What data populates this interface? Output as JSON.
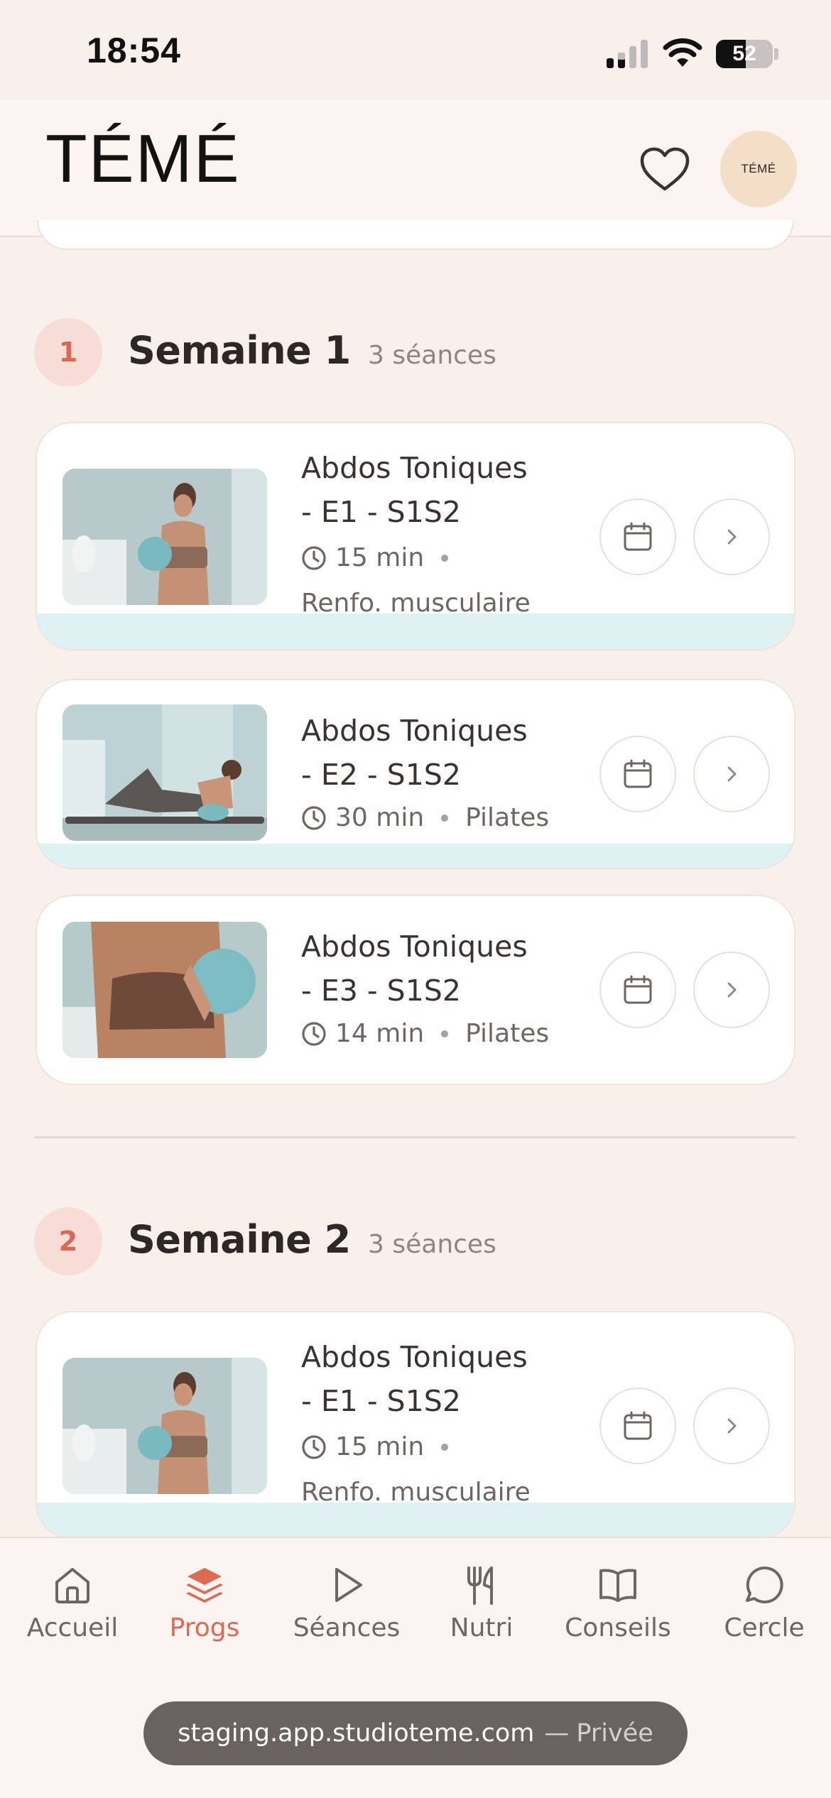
{
  "status_bar": {
    "time": "18:54",
    "battery": "52",
    "battery_level": 0.52
  },
  "header": {
    "logo": "TÉMÉ",
    "avatar_text": "TÉMÉ",
    "favorite_icon": "heart-icon"
  },
  "weeks": [
    {
      "number": "1",
      "title": "Semaine 1",
      "count": "3 séances",
      "sessions": [
        {
          "title_line1": "Abdos Toniques",
          "title_line2": "- E1 - S1S2",
          "duration": "15 min",
          "category": "Renfo. musculaire"
        },
        {
          "title_line1": "Abdos Toniques",
          "title_line2": "- E2 - S1S2",
          "duration": "30 min",
          "category": "Pilates"
        },
        {
          "title_line1": "Abdos Toniques",
          "title_line2": "- E3 - S1S2",
          "duration": "14 min",
          "category": "Pilates"
        }
      ]
    },
    {
      "number": "2",
      "title": "Semaine 2",
      "count": "3 séances",
      "sessions": [
        {
          "title_line1": "Abdos Toniques",
          "title_line2": "- E1 - S1S2",
          "duration": "15 min",
          "category": "Renfo. musculaire"
        }
      ]
    }
  ],
  "tabbar": {
    "items": [
      {
        "label": "Accueil",
        "icon": "home-icon",
        "active": false
      },
      {
        "label": "Progs",
        "icon": "layers-icon",
        "active": true
      },
      {
        "label": "Séances",
        "icon": "play-icon",
        "active": false
      },
      {
        "label": "Nutri",
        "icon": "fork-knife-icon",
        "active": false
      },
      {
        "label": "Conseils",
        "icon": "book-icon",
        "active": false
      },
      {
        "label": "Cercle",
        "icon": "chat-bubble-icon",
        "active": false
      }
    ]
  },
  "browser": {
    "url": "staging.app.studioteme.com",
    "separator": "—",
    "mode": "Privée"
  },
  "colors": {
    "accent": "#dd6a54",
    "background": "#f9efeb",
    "progress": "#dff1f3"
  }
}
